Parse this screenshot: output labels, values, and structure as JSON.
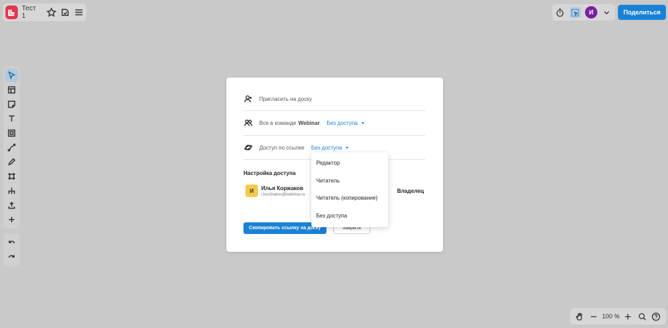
{
  "header": {
    "board_title": "Тест 1",
    "avatar_letter": "И",
    "share_label": "Поделиться"
  },
  "modal": {
    "invite_placeholder": "Пригласить на доску",
    "team_prefix": "Все в команде",
    "team_name": "Webinar",
    "team_access": "Без доступа",
    "link_label": "Доступ по ссылке",
    "link_access": "Без доступа",
    "section_title": "Настройка доступа",
    "user": {
      "avatar_letter": "И",
      "name": "Илья Коржаков",
      "email": "i.korzhakov@webinar.ru",
      "role": "Владелец"
    },
    "copy_button": "Скопировать ссылку на доску",
    "close_button": "Закрыть"
  },
  "dropdown": {
    "items": [
      "Редактор",
      "Читатель",
      "Читатель (копирование)",
      "Без доступа"
    ]
  },
  "zoom": {
    "level": "100 %"
  },
  "icons": {
    "toolbar": [
      "cursor-icon",
      "template-icon",
      "sticky-note-icon",
      "text-icon",
      "frame-icon",
      "connector-icon",
      "pen-icon",
      "crop-icon",
      "mindmap-icon",
      "upload-icon",
      "plus-icon"
    ],
    "undo": "undo-icon",
    "redo": "redo-icon"
  },
  "colors": {
    "accent": "#1a82d6",
    "logo": "#e0384f",
    "avatar": "#7b1fa2",
    "user_avatar": "#f6c94a",
    "canvas": "#c9c9c9"
  }
}
